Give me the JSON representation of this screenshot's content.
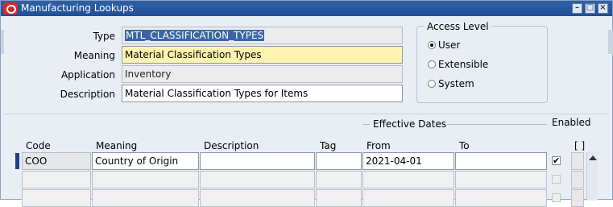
{
  "window": {
    "title": "Manufacturing Lookups"
  },
  "header": {
    "type_label": "Type",
    "type_value": "MTL_CLASSIFICATION_TYPES",
    "meaning_label": "Meaning",
    "meaning_value": "Material Classification Types",
    "application_label": "Application",
    "application_value": "Inventory",
    "description_label": "Description",
    "description_value": "Material Classification Types for Items"
  },
  "access_level": {
    "title": "Access Level",
    "options": [
      {
        "label": "User",
        "selected": true
      },
      {
        "label": "Extensible",
        "selected": false
      },
      {
        "label": "System",
        "selected": false
      }
    ]
  },
  "lines": {
    "effective_dates_label": "Effective Dates",
    "enabled_label": "Enabled",
    "flex_label": "[ ]",
    "columns": [
      "Code",
      "Meaning",
      "Description",
      "Tag",
      "From",
      "To"
    ],
    "rows": [
      {
        "code": "COO",
        "meaning": "Country of Origin",
        "description": "",
        "tag": "",
        "from": "2021-04-01",
        "to": "",
        "enabled": "✔"
      },
      {
        "code": "",
        "meaning": "",
        "description": "",
        "tag": "",
        "from": "",
        "to": "",
        "enabled": ""
      },
      {
        "code": "",
        "meaning": "",
        "description": "",
        "tag": "",
        "from": "",
        "to": "",
        "enabled": ""
      }
    ]
  },
  "icons": {
    "app": "oracle-icon",
    "minimize": "minimize-icon",
    "maximize": "maximize-icon",
    "close": "close-icon"
  }
}
